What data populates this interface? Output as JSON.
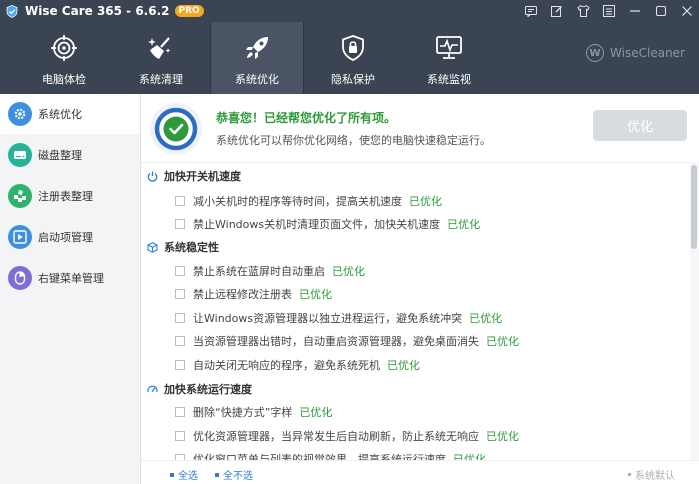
{
  "app": {
    "title": "Wise Care 365 - 6.6.2",
    "badge": "PRO"
  },
  "titlebar": {
    "controls": [
      "message-icon",
      "edit-icon",
      "shirt-icon",
      "menu-icon",
      "minimize-icon",
      "maximize-icon",
      "close-icon"
    ]
  },
  "topnav": {
    "items": [
      {
        "label": "电脑体检",
        "icon": "target-icon"
      },
      {
        "label": "系统清理",
        "icon": "broom-icon"
      },
      {
        "label": "系统优化",
        "icon": "rocket-icon",
        "active": true
      },
      {
        "label": "隐私保护",
        "icon": "lock-shield-icon"
      },
      {
        "label": "系统监视",
        "icon": "monitor-icon"
      }
    ],
    "brand": "WiseCleaner",
    "brand_mark": "W"
  },
  "sidebar": {
    "items": [
      {
        "label": "系统优化",
        "color": "#3d8fe0",
        "active": true
      },
      {
        "label": "磁盘整理",
        "color": "#27b39a"
      },
      {
        "label": "注册表整理",
        "color": "#2fb36a"
      },
      {
        "label": "启动项管理",
        "color": "#3d8fe0"
      },
      {
        "label": "右键菜单管理",
        "color": "#7d6fd6"
      }
    ]
  },
  "status": {
    "title": "恭喜您！已经帮您优化了所有项。",
    "subtitle": "系统优化可以帮你优化网络，使您的电脑快速稳定运行。",
    "button": "优化",
    "accent": "#2e9a3a",
    "ring_color": "#2c6cc4"
  },
  "sections": [
    {
      "title": "加快开关机速度",
      "items": [
        {
          "text": "减小关机时的程序等待时间，提高关机速度",
          "status": "已优化"
        },
        {
          "text": "禁止Windows关机时清理页面文件，加快关机速度",
          "status": "已优化"
        }
      ]
    },
    {
      "title": "系统稳定性",
      "items": [
        {
          "text": "禁止系统在蓝屏时自动重启",
          "status": "已优化"
        },
        {
          "text": "禁止远程修改注册表",
          "status": "已优化"
        },
        {
          "text": "让Windows资源管理器以独立进程运行，避免系统冲突",
          "status": "已优化"
        },
        {
          "text": "当资源管理器出错时，自动重启资源管理器，避免桌面消失",
          "status": "已优化"
        },
        {
          "text": "自动关闭无响应的程序，避免系统死机",
          "status": "已优化"
        }
      ]
    },
    {
      "title": "加快系统运行速度",
      "items": [
        {
          "text": "删除“快捷方式”字样",
          "status": "已优化"
        },
        {
          "text": "优化资源管理器，当异常发生后自动刷新，防止系统无响应",
          "status": "已优化"
        },
        {
          "text": "优化窗口菜单与列表的视觉效果，提高系统运行速度",
          "status": "已优化"
        }
      ]
    }
  ],
  "footer": {
    "select_all": "全选",
    "select_none": "全不选",
    "default": "系统默认"
  }
}
